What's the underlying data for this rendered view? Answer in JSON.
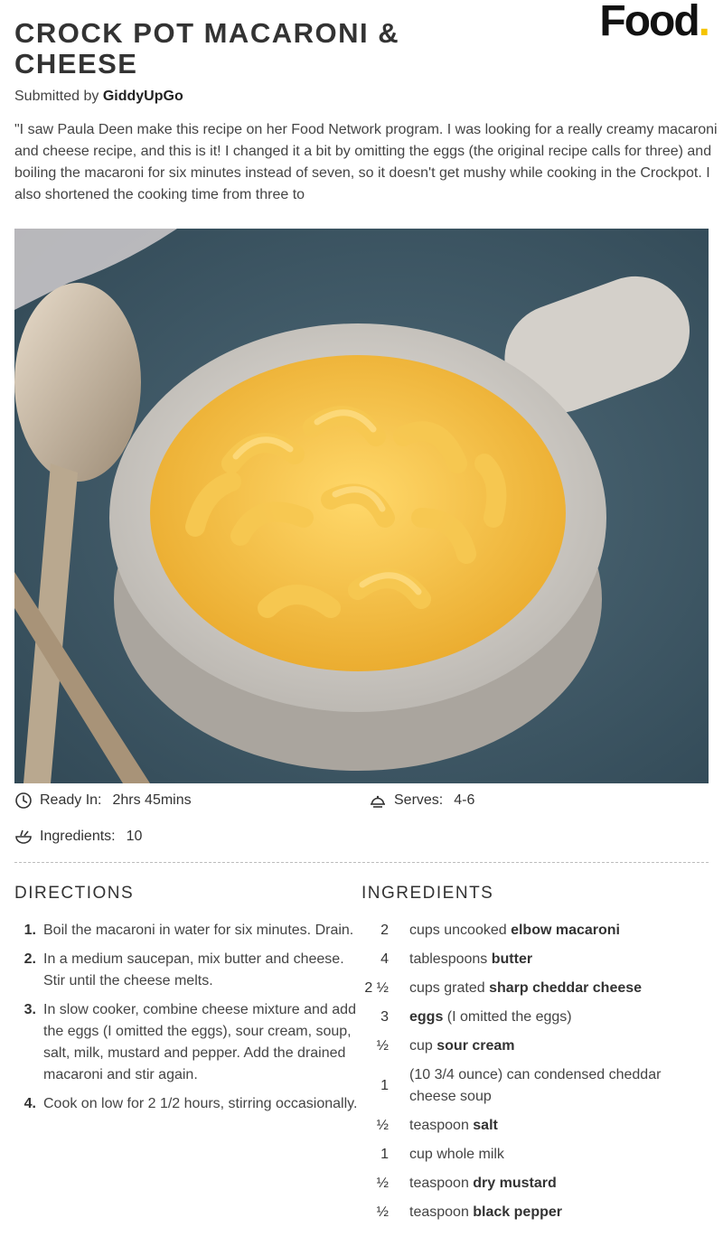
{
  "brand": {
    "logo_text": "Food",
    "logo_dot": ".",
    "accent": "#f5c400"
  },
  "recipe": {
    "title": "CROCK POT MACARONI & CHEESE",
    "submitted_prefix": "Submitted by",
    "author": "GiddyUpGo",
    "description": "\"I saw Paula Deen make this recipe on her Food Network program. I was looking for a really creamy macaroni and cheese recipe, and this is it! I changed it a bit by omitting the eggs (the original recipe calls for three) and boiling the macaroni for six minutes instead of seven, so it doesn't get mushy while cooking in the Crockpot. I also shortened the cooking time from three to",
    "ready_in_label": "Ready In:",
    "ready_in_value": "2hrs 45mins",
    "serves_label": "Serves:",
    "serves_value": "4-6",
    "ingredients_label": "Ingredients:",
    "ingredients_value": "10"
  },
  "directions": {
    "heading": "DIRECTIONS",
    "steps": [
      {
        "num": "1.",
        "text": "Boil the macaroni in water for six minutes. Drain."
      },
      {
        "num": "2.",
        "text": "In a medium saucepan, mix butter and cheese. Stir until the cheese melts."
      },
      {
        "num": "3.",
        "text": "In slow cooker, combine cheese mixture and add the eggs (I omitted the eggs), sour cream, soup, salt, milk, mustard and pepper. Add the drained macaroni and stir again."
      },
      {
        "num": "4.",
        "text": "Cook on low for 2 1/2 hours, stirring occasionally."
      }
    ]
  },
  "ingredients": {
    "heading": "INGREDIENTS",
    "items": [
      {
        "qty": "2",
        "pre": "cups uncooked ",
        "bold": "elbow macaroni",
        "post": ""
      },
      {
        "qty": "4",
        "pre": "tablespoons ",
        "bold": "butter",
        "post": ""
      },
      {
        "qty": "2 ½",
        "pre": "cups grated ",
        "bold": "sharp cheddar cheese",
        "post": ""
      },
      {
        "qty": "3",
        "pre": "",
        "bold": "eggs",
        "post": " (I omitted the eggs)"
      },
      {
        "qty": "½",
        "pre": "cup ",
        "bold": "sour cream",
        "post": ""
      },
      {
        "qty": "1",
        "pre": "(10 3/4 ounce) can condensed cheddar cheese soup",
        "bold": "",
        "post": ""
      },
      {
        "qty": "½",
        "pre": "teaspoon ",
        "bold": "salt",
        "post": ""
      },
      {
        "qty": "1",
        "pre": "cup whole milk",
        "bold": "",
        "post": ""
      },
      {
        "qty": "½",
        "pre": "teaspoon ",
        "bold": "dry mustard",
        "post": ""
      },
      {
        "qty": "½",
        "pre": "teaspoon ",
        "bold": "black pepper",
        "post": ""
      }
    ]
  },
  "icons": {
    "ready_in": "clock-icon",
    "serves": "serving-dish-icon",
    "ingredients": "bowl-icon"
  }
}
